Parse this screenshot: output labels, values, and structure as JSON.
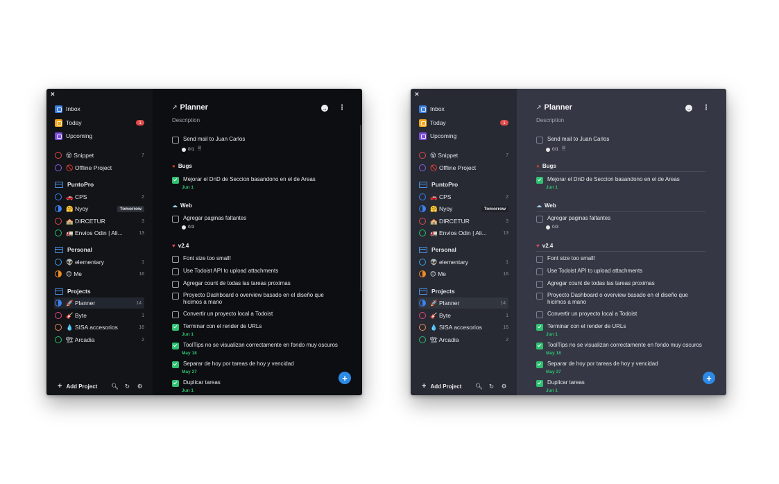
{
  "windows": [
    {
      "theme": "dark",
      "close": "×",
      "sidebar": {
        "inbox": "Inbox",
        "today": "Today",
        "today_badge": "1",
        "upcoming": "Upcoming",
        "snippet": "😵 Snippet",
        "snippet_count": "7",
        "offline": "🚫 Offline Project",
        "puntopro": "PuntoPro",
        "cps": "🚗 CPS",
        "cps_count": "2",
        "nyoy": "🤗 Nyoy",
        "nyoy_tag": "Tomorrow",
        "dircetur": "🏫 DIRCETUR",
        "dircetur_count": "3",
        "envios": "🚛 Envios Odin | Ali...",
        "envios_count": "13",
        "personal": "Personal",
        "elementary": "👽 elementary",
        "elementary_count": "1",
        "me": "😊 Me",
        "me_count": "16",
        "projects": "Projects",
        "planner": "🚀 Planner",
        "planner_count": "14",
        "byte": "🎸 Byte",
        "byte_count": "1",
        "sisa": "💧 SISA accesorios",
        "sisa_count": "16",
        "arcadia": "🏗 Arcadia",
        "arcadia_count": "2",
        "add_project": "Add Project"
      },
      "main": {
        "title": "Planner",
        "description": "Description",
        "t1": "Send mail to Juan Carlos",
        "t1_sub": "0/1",
        "sec_bugs": "Bugs",
        "t2": "Mejorar el DnD de Seccion basandono en el de Areas",
        "t2_date": "Jun 1",
        "sec_web": "Web",
        "t3": "Agregar paginas faltantes",
        "t3_sub": "0/3",
        "sec_v24": "v2.4",
        "t4": "Font size too small!",
        "t5": "Use Todoist API to upload attachments",
        "t6": "Agregar count de todas las tareas proximas",
        "t7": "Proyecto Dashboard o overview basado en el diseño que hicimos a mano",
        "t8": "Convertir un proyecto local a Todoist",
        "t9": "Terminar con el render de URLs",
        "t9_date": "Jun 1",
        "t10": "ToolTips no se visualizan correctamente en fondo muy oscuros",
        "t10_date": "May 18",
        "t11": "Separar de hoy por tareas de hoy y vencidad",
        "t11_date": "May 27",
        "t12": "Duplicar tareas",
        "t12_date": "Jun 1"
      }
    },
    {
      "theme": "slate",
      "close": "×",
      "sidebar": {
        "inbox": "Inbox",
        "today": "Today",
        "today_badge": "1",
        "upcoming": "Upcoming",
        "snippet": "😵 Snippet",
        "snippet_count": "7",
        "offline": "🚫 Offline Project",
        "puntopro": "PuntoPro",
        "cps": "🚗 CPS",
        "cps_count": "2",
        "nyoy": "🤗 Nyoy",
        "nyoy_tag": "Tomorrow",
        "dircetur": "🏫 DIRCETUR",
        "dircetur_count": "3",
        "envios": "🚛 Envios Odin | Ali...",
        "envios_count": "13",
        "personal": "Personal",
        "elementary": "👽 elementary",
        "elementary_count": "1",
        "me": "😊 Me",
        "me_count": "16",
        "projects": "Projects",
        "planner": "🚀 Planner",
        "planner_count": "14",
        "byte": "🎸 Byte",
        "byte_count": "1",
        "sisa": "💧 SISA accesorios",
        "sisa_count": "16",
        "arcadia": "🏗 Arcadia",
        "arcadia_count": "2",
        "add_project": "Add Project"
      },
      "main": {
        "title": "Planner",
        "description": "Description",
        "t1": "Send mail to Juan Carlos",
        "t1_sub": "0/1",
        "sec_bugs": "Bugs",
        "t2": "Mejorar el DnD de Seccion basandono en el de Areas",
        "t2_date": "Jun 1",
        "sec_web": "Web",
        "t3": "Agregar paginas faltantes",
        "t3_sub": "0/3",
        "sec_v24": "v2.4",
        "t4": "Font size too small!",
        "t5": "Use Todoist API to upload attachments",
        "t6": "Agregar count de todas las tareas proximas",
        "t7": "Proyecto Dashboard o overview basado en el diseño que hicimos a mano",
        "t8": "Convertir un proyecto local a Todoist",
        "t9": "Terminar con el render de URLs",
        "t9_date": "Jun 1",
        "t10": "ToolTips no se visualizan correctamente en fondo muy oscuros",
        "t10_date": "May 18",
        "t11": "Separar de hoy por tareas de hoy y vencidad",
        "t11_date": "May 27",
        "t12": "Duplicar tareas",
        "t12_date": "Jun 1"
      }
    }
  ],
  "icons": {
    "rocket": "rocket-icon",
    "add": "plus-icon",
    "search": "search-icon",
    "sync": "sync-icon",
    "settings": "gear-icon"
  },
  "colors": {
    "accent": "#2d8ae6",
    "done": "#2fbf71",
    "badge": "#e04b4b"
  }
}
